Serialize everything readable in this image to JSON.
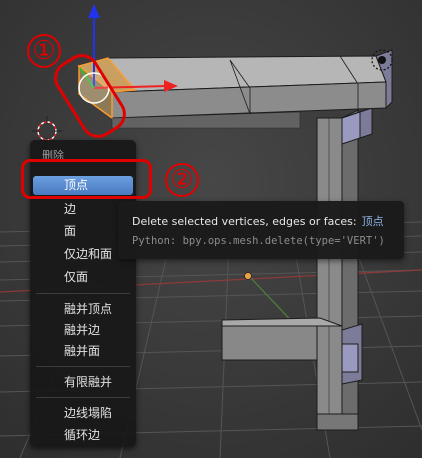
{
  "viewport": {
    "description_icons": [
      "transform-arrow-z-icon",
      "transform-arrow-x-icon",
      "3d-cursor-icon",
      "lamp-icon"
    ]
  },
  "menu": {
    "title": "删除",
    "items": [
      {
        "label": "顶点",
        "active": true
      },
      {
        "label": "边",
        "active": false
      },
      {
        "label": "面",
        "active": false
      },
      {
        "label": "仅边和面",
        "active": false
      },
      {
        "label": "仅面",
        "active": false
      },
      {
        "label": "融并顶点",
        "active": false
      },
      {
        "label": "融并边",
        "active": false
      },
      {
        "label": "融并面",
        "active": false
      },
      {
        "label": "有限融并",
        "active": false
      },
      {
        "label": "边线塌陷",
        "active": false
      },
      {
        "label": "循环边",
        "active": false
      }
    ]
  },
  "tooltip": {
    "description": "Delete selected vertices, edges or faces:",
    "value": "顶点",
    "python": "Python: bpy.ops.mesh.delete(type='VERT')"
  },
  "annotations": {
    "marker1": "①",
    "marker2": "②"
  },
  "colors": {
    "annotation_red": "#e00000",
    "menu_highlight": "#5a8bd0",
    "selected_face": "#e8a040"
  }
}
